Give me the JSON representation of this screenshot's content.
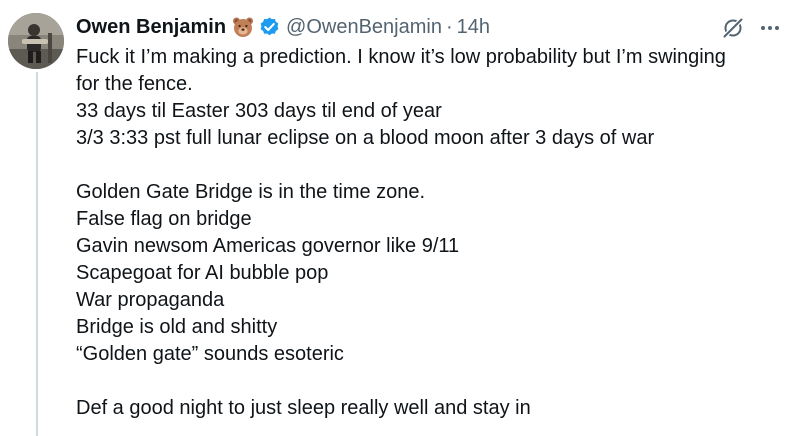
{
  "author": {
    "display_name": "Owen Benjamin",
    "handle": "@OwenBenjamin",
    "separator": "·",
    "time": "14h",
    "badge_icon": "bear-face-icon",
    "verified_icon": "verified-badge-icon",
    "verified_color": "#1d9bf0"
  },
  "actions": {
    "grok_icon": "grok-icon",
    "more_icon": "more-options-icon"
  },
  "tweet": {
    "lines": [
      "Fuck it I’m making a prediction. I know it’s low probability but I’m swinging",
      "for the fence.",
      "33 days til Easter 303 days til end of year",
      "3/3 3:33 pst full lunar eclipse on a blood moon after 3 days of war",
      "",
      "Golden Gate Bridge is in the time zone.",
      "False flag on bridge",
      "Gavin newsom Americas governor like 9/11",
      "Scapegoat for AI bubble pop",
      "War propaganda",
      "Bridge is old and shitty",
      "“Golden gate” sounds esoteric",
      "",
      "Def a good night to just sleep really well and stay in"
    ]
  },
  "colors": {
    "text": "#0f1419",
    "secondary_text": "#536471",
    "thread_line": "#cfd9de"
  }
}
